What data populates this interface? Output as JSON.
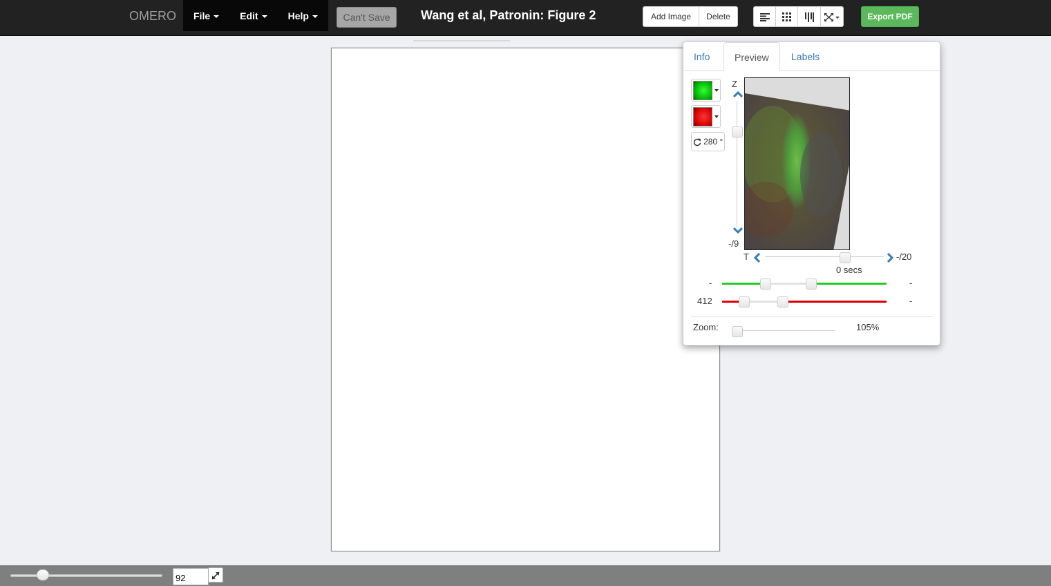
{
  "navbar": {
    "brand": "OMERO",
    "menus": [
      {
        "label": "File"
      },
      {
        "label": "Edit"
      },
      {
        "label": "Help"
      }
    ],
    "save_label": "Can't Save",
    "figure_title": "Wang et al, Patronin: Figure 2",
    "add_image_label": "Add Image",
    "delete_label": "Delete",
    "layout_icons": [
      "align-left-icon",
      "grid-icon",
      "columns-icon",
      "fullscreen-icon"
    ],
    "export_label": "Export PDF"
  },
  "panel": {
    "tabs": [
      {
        "label": "Info",
        "active": false
      },
      {
        "label": "Preview",
        "active": true
      },
      {
        "label": "Labels",
        "active": false
      }
    ],
    "channels": [
      {
        "color": "#00ff00",
        "start_label": "-",
        "end_label": "-",
        "line_color": "#22cc22"
      },
      {
        "color": "#ff0000",
        "start_label": "412",
        "end_label": "-",
        "line_color": "#dd0000"
      }
    ],
    "rotation_label": "280 °",
    "z_label": "Z",
    "z_max_label": "-/9",
    "t_label": "T",
    "t_max_label": "-/20",
    "time_label": "0 secs",
    "zoom_label": "Zoom:",
    "zoom_value": "105%"
  },
  "bottom": {
    "zoom_value": "92"
  },
  "colors": {
    "navbar_bg": "#222222",
    "accent": "#337ab7",
    "export_green": "#5cb85c"
  }
}
